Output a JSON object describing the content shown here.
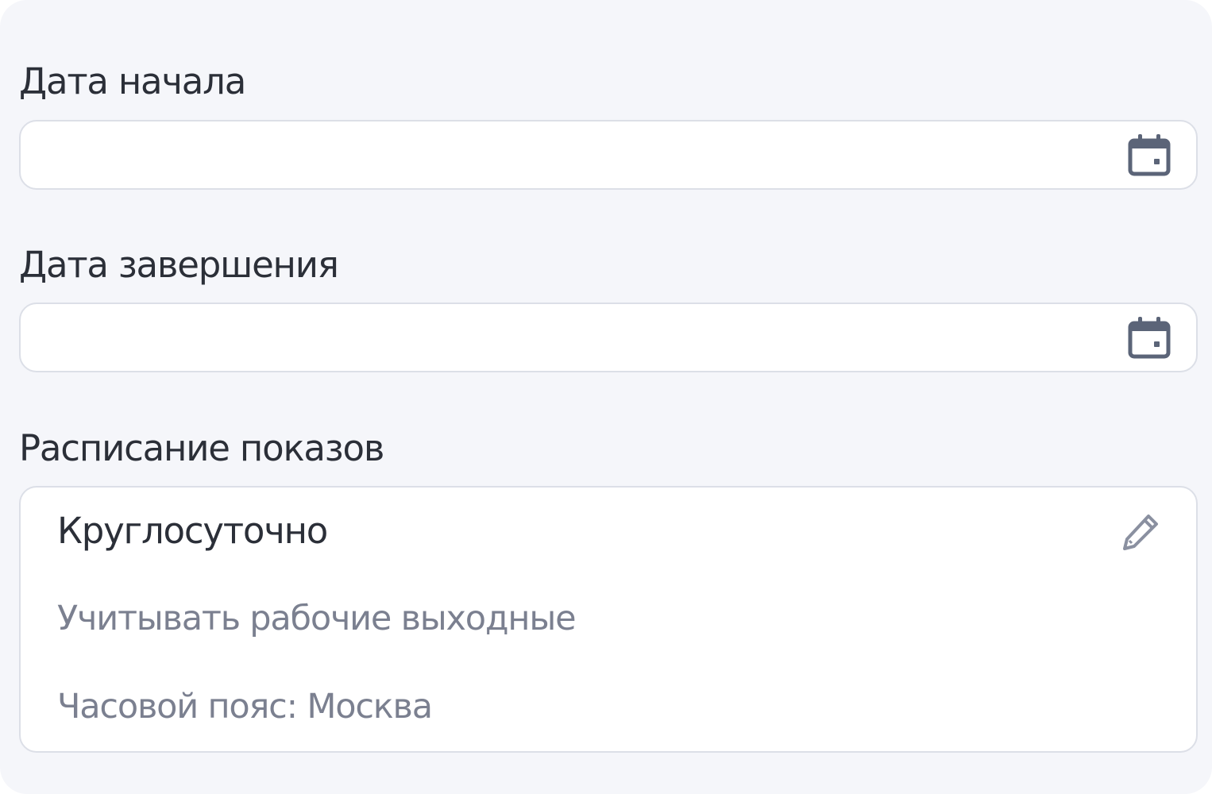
{
  "start_date": {
    "label": "Дата начала",
    "value": "",
    "placeholder": "",
    "icon": "calendar-icon"
  },
  "end_date": {
    "label": "Дата завершения",
    "value": "",
    "placeholder": "",
    "icon": "calendar-icon"
  },
  "schedule": {
    "label": "Расписание показов",
    "mode": "Круглосуточно",
    "holidays_option": "Учитывать рабочие выходные",
    "timezone": "Часовой пояс: Москва",
    "edit_icon": "pencil-icon"
  },
  "colors": {
    "panel_background": "#f5f6fa",
    "field_border": "#dcdfe7",
    "primary_text": "#2b2f38",
    "secondary_text": "#7b8090",
    "icon_color": "#5b6478"
  }
}
